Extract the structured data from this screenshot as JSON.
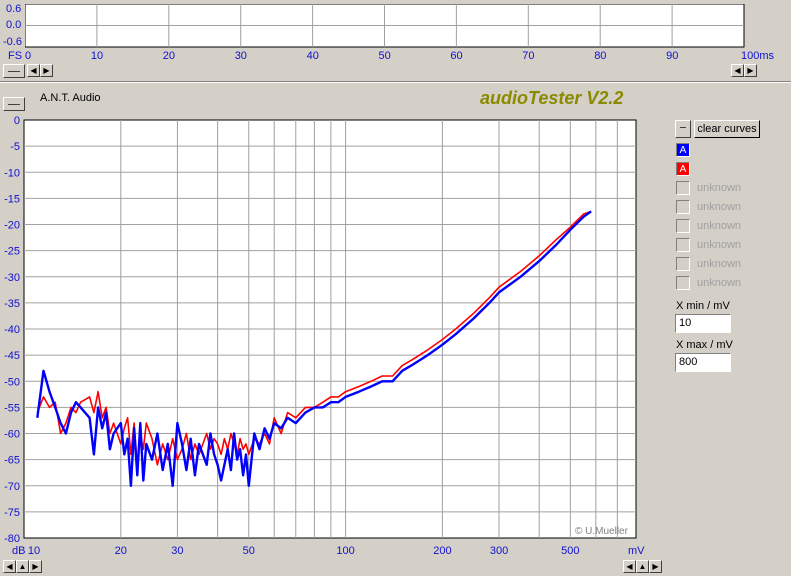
{
  "top_panel": {
    "y_ticks": [
      "0.6",
      "0.0",
      "-0.6"
    ],
    "x_unit_left": "FS",
    "x_ticks": [
      "0",
      "10",
      "20",
      "30",
      "40",
      "50",
      "60",
      "70",
      "80",
      "90",
      "100ms"
    ]
  },
  "header": {
    "app_label": "A.N.T. Audio",
    "title": "audioTester V2.2"
  },
  "legend": {
    "clear_label": "clear curves",
    "items": [
      {
        "text": "A",
        "color": "#0000ff",
        "enabled": true
      },
      {
        "text": "A",
        "color": "#ff0000",
        "enabled": true
      },
      {
        "text": "unknown",
        "enabled": false
      },
      {
        "text": "unknown",
        "enabled": false
      },
      {
        "text": "unknown",
        "enabled": false
      },
      {
        "text": "unknown",
        "enabled": false
      },
      {
        "text": "unknown",
        "enabled": false
      },
      {
        "text": "unknown",
        "enabled": false
      }
    ],
    "xmin_label": "X min / mV",
    "xmin_value": "10",
    "xmax_label": "X max / mV",
    "xmax_value": "800"
  },
  "chart_data": {
    "type": "line",
    "ylabel": "dB",
    "xlabel": "mV",
    "x_scale": "log",
    "xlim": [
      10,
      800
    ],
    "ylim": [
      -80,
      0
    ],
    "y_ticks": [
      0,
      -5,
      -10,
      -15,
      -20,
      -25,
      -30,
      -35,
      -40,
      -45,
      -50,
      -55,
      -60,
      -65,
      -70,
      -75,
      -80
    ],
    "x_tick_labels": [
      {
        "value": 10,
        "label": "10"
      },
      {
        "value": 20,
        "label": "20"
      },
      {
        "value": 30,
        "label": "30"
      },
      {
        "value": 50,
        "label": "50"
      },
      {
        "value": 100,
        "label": "100"
      },
      {
        "value": 200,
        "label": "200"
      },
      {
        "value": 300,
        "label": "300"
      },
      {
        "value": 500,
        "label": "500"
      }
    ],
    "grid": true,
    "watermark": "© U.Mueller",
    "series": [
      {
        "color": "#0000ff",
        "x": [
          11,
          11.5,
          12,
          12.5,
          13,
          13.5,
          14,
          14.5,
          15,
          16,
          16.5,
          17,
          17.5,
          18,
          18.5,
          19,
          20,
          20.5,
          21,
          21.5,
          22,
          22.5,
          23,
          23.5,
          24,
          25,
          26,
          27,
          28,
          29,
          30,
          31,
          32,
          33,
          34,
          35,
          36,
          37,
          38,
          39,
          40,
          41,
          42,
          43,
          44,
          45,
          46,
          47,
          48,
          49,
          50,
          52,
          54,
          56,
          58,
          60,
          63,
          66,
          70,
          75,
          80,
          85,
          90,
          95,
          100,
          110,
          120,
          130,
          140,
          150,
          160,
          180,
          200,
          220,
          250,
          280,
          300,
          350,
          400,
          450,
          500,
          550,
          580
        ],
        "y": [
          -57,
          -48,
          -52,
          -55,
          -58,
          -60,
          -56,
          -54,
          -55,
          -57,
          -64,
          -55,
          -59,
          -56,
          -63,
          -60,
          -58,
          -64,
          -61,
          -70,
          -59,
          -68,
          -58,
          -69,
          -62,
          -65,
          -60,
          -67,
          -62,
          -70,
          -58,
          -62,
          -67,
          -61,
          -68,
          -62,
          -64,
          -66,
          -60,
          -64,
          -66,
          -69,
          -66,
          -63,
          -67,
          -60,
          -65,
          -63,
          -68,
          -64,
          -70,
          -60,
          -63,
          -59,
          -61,
          -58,
          -59,
          -57,
          -58,
          -56,
          -55,
          -55,
          -54,
          -54,
          -53,
          -52,
          -51,
          -50,
          -50,
          -48,
          -47,
          -45,
          -43,
          -41,
          -38,
          -35,
          -33,
          -30,
          -27,
          -24,
          -21,
          -18.5,
          -17.5
        ]
      },
      {
        "color": "#ff0000",
        "x": [
          11,
          11.5,
          12,
          12.5,
          13,
          13.5,
          14,
          14.5,
          15,
          16,
          16.5,
          17,
          17.5,
          18,
          18.5,
          19,
          20,
          20.5,
          21,
          21.5,
          22,
          22.5,
          23,
          23.5,
          24,
          25,
          26,
          27,
          28,
          29,
          30,
          31,
          32,
          33,
          34,
          35,
          36,
          37,
          38,
          39,
          40,
          41,
          42,
          43,
          44,
          45,
          46,
          47,
          48,
          49,
          50,
          52,
          54,
          56,
          58,
          60,
          63,
          66,
          70,
          75,
          80,
          85,
          90,
          95,
          100,
          110,
          120,
          130,
          140,
          150,
          160,
          180,
          200,
          220,
          250,
          280,
          300,
          350,
          400,
          450,
          500,
          550,
          580
        ],
        "y": [
          -56,
          -53,
          -55,
          -54,
          -60,
          -58,
          -55,
          -56,
          -54,
          -53,
          -56,
          -52,
          -57,
          -55,
          -60,
          -58,
          -62,
          -59,
          -57,
          -64,
          -58,
          -66,
          -60,
          -63,
          -58,
          -61,
          -66,
          -62,
          -65,
          -61,
          -65,
          -63,
          -60,
          -65,
          -62,
          -64,
          -62,
          -60,
          -63,
          -61,
          -62,
          -64,
          -61,
          -63,
          -60,
          -62,
          -64,
          -61,
          -63,
          -62,
          -64,
          -61,
          -62,
          -60,
          -62,
          -57,
          -60,
          -56,
          -57,
          -55,
          -55,
          -54,
          -53,
          -53,
          -52,
          -51,
          -50,
          -49,
          -49,
          -47,
          -46,
          -44,
          -42,
          -40,
          -37,
          -34,
          -32,
          -29,
          -26,
          -23,
          -20.5,
          -18,
          -17.5
        ]
      }
    ]
  }
}
